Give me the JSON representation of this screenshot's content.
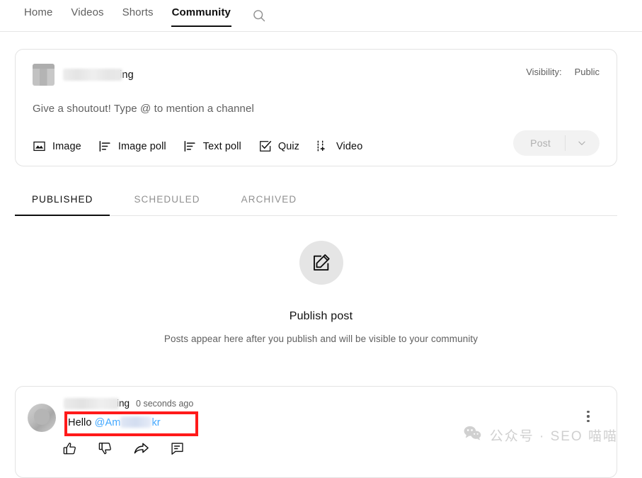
{
  "nav": {
    "tabs": [
      {
        "label": "Home",
        "active": false
      },
      {
        "label": "Videos",
        "active": false
      },
      {
        "label": "Shorts",
        "active": false
      },
      {
        "label": "Community",
        "active": true
      }
    ],
    "search_icon": "search-icon"
  },
  "composer": {
    "channel_name_tail": "ing",
    "visibility_label": "Visibility:",
    "visibility_value": "Public",
    "placeholder": "Give a shoutout! Type @ to mention a channel",
    "tools": [
      {
        "label": "Image",
        "icon": "image-icon"
      },
      {
        "label": "Image poll",
        "icon": "image-poll-icon"
      },
      {
        "label": "Text poll",
        "icon": "text-poll-icon"
      },
      {
        "label": "Quiz",
        "icon": "quiz-icon"
      },
      {
        "label": "Video",
        "icon": "video-icon"
      }
    ],
    "post_button": {
      "label": "Post",
      "enabled": false,
      "dropdown_icon": "chevron-down-icon"
    }
  },
  "section_tabs": [
    {
      "label": "PUBLISHED",
      "active": true
    },
    {
      "label": "SCHEDULED",
      "active": false
    },
    {
      "label": "ARCHIVED",
      "active": false
    }
  ],
  "empty_state": {
    "icon": "pencil-square-icon",
    "title": "Publish post",
    "subtitle": "Posts appear here after you publish and will be visible to your community"
  },
  "post": {
    "author_name_tail": "ing",
    "timestamp": "0 seconds ago",
    "text_prefix": "Hello ",
    "mention_prefix": "@Am",
    "mention_suffix": "kr",
    "highlight_color": "#ff1a1a",
    "mention_color": "#3ea6ff",
    "actions": [
      {
        "name": "like-icon"
      },
      {
        "name": "dislike-icon"
      },
      {
        "name": "share-icon"
      },
      {
        "name": "comment-icon"
      }
    ],
    "menu_icon": "kebab-menu-icon"
  },
  "watermark": {
    "icon": "wechat-icon",
    "text": "公众号 · SEO 喵喵"
  }
}
